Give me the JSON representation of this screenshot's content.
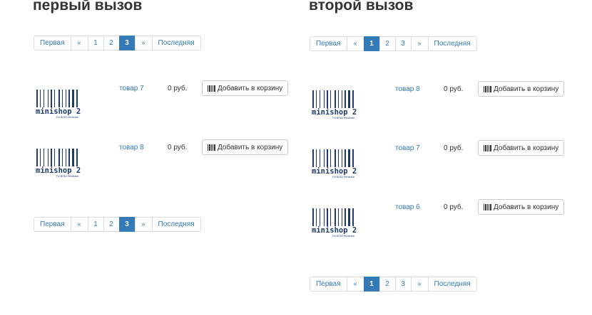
{
  "columns": [
    {
      "heading": "первый вызов",
      "pagination": {
        "first": "Первая",
        "prev": "«",
        "pages": [
          "1",
          "2",
          "3"
        ],
        "active": "3",
        "next": "»",
        "last": "Последняя"
      },
      "products": [
        {
          "name": "товар 7",
          "price": "0 руб.",
          "button": "Добавить в корзину"
        },
        {
          "name": "товар 8",
          "price": "0 руб.",
          "button": "Добавить в корзину"
        }
      ]
    },
    {
      "heading": "второй вызов",
      "pagination": {
        "first": "Первая",
        "prev": "«",
        "pages": [
          "1",
          "2",
          "3"
        ],
        "active": "1",
        "next": "»",
        "last": "Последняя"
      },
      "products": [
        {
          "name": "товар 8",
          "price": "0 руб.",
          "button": "Добавить в корзину"
        },
        {
          "name": "товар 7",
          "price": "0 руб.",
          "button": "Добавить в корзину"
        },
        {
          "name": "товар 6",
          "price": "0 руб.",
          "button": "Добавить в корзину"
        }
      ]
    }
  ],
  "logo": {
    "text": "minishop 2",
    "tagline": "For MODX Revolution",
    "color": "#1f3a6e"
  },
  "colors": {
    "link": "#337ab7",
    "active_page_bg": "#337ab7"
  },
  "icons": {
    "cart_button": "barcode-icon"
  }
}
